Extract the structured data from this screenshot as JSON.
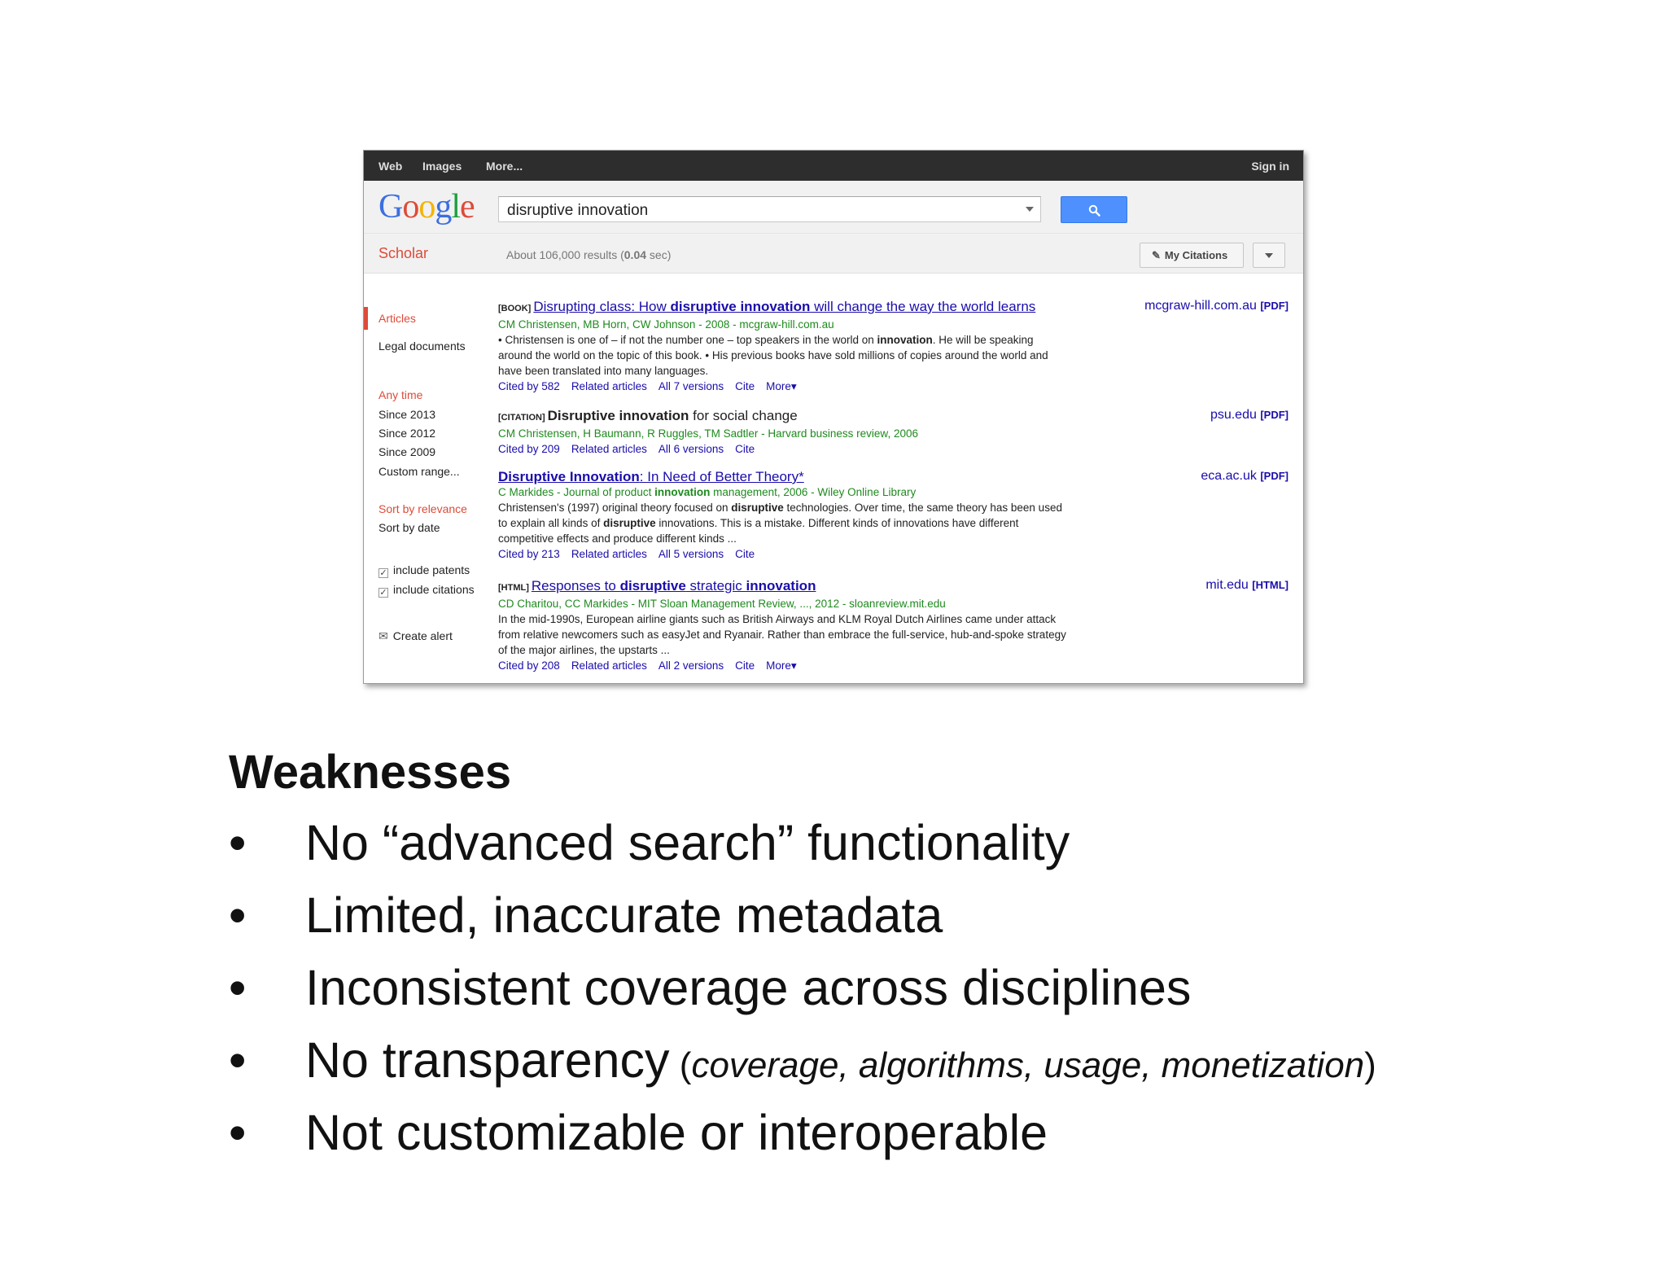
{
  "topbar": {
    "nav": [
      "Web",
      "Images",
      "More..."
    ],
    "signin": "Sign in"
  },
  "logo": {
    "letters": [
      "G",
      "o",
      "o",
      "g",
      "l",
      "e"
    ],
    "colors": [
      "#3c6fe0",
      "#dd4b39",
      "#f4b400",
      "#3c6fe0",
      "#1e9e3e",
      "#dd4b39"
    ]
  },
  "search": {
    "value": "disruptive innovation"
  },
  "subheader": {
    "scholar": "Scholar",
    "stats_prefix": "About 106,000 results (",
    "stats_time": "0.04",
    "stats_suffix": " sec)",
    "my_citations": "My Citations"
  },
  "leftcol": {
    "types": [
      "Articles",
      "Legal documents"
    ],
    "time": [
      "Any time",
      "Since 2013",
      "Since 2012",
      "Since 2009",
      "Custom range..."
    ],
    "sort": [
      "Sort by relevance",
      "Sort by date"
    ],
    "include": [
      "include patents",
      "include citations"
    ],
    "alert": "Create alert"
  },
  "results": [
    {
      "tag": "[BOOK]",
      "title_a": "Disrupting class: How ",
      "title_b": "disruptive innovation",
      "title_c": " will change the way the world learns",
      "meta": "CM Christensen, MB Horn, CW Johnson - 2008 - mcgraw-hill.com.au",
      "snippet_1": "• Christensen is one of – if not the number one – top speakers in the world on ",
      "snippet_bold": "innovation",
      "snippet_2": ". He will be speaking around the world on the topic of this book. • His previous books have sold millions of copies around the world and have been translated into many languages.",
      "links": [
        "Cited by 582",
        "Related articles",
        "All 7 versions",
        "Cite",
        "More▾"
      ],
      "side_domain": "mcgraw-hill.com.au",
      "side_fmt": "[PDF]"
    },
    {
      "tag": "[CITATION]",
      "title_a": "",
      "title_b": "Disruptive innovation",
      "title_c": " for social change",
      "meta": "CM Christensen, H Baumann, R Ruggles, TM Sadtler - Harvard business review, 2006",
      "links": [
        "Cited by 209",
        "Related articles",
        "All 6 versions",
        "Cite"
      ],
      "side_domain": "psu.edu",
      "side_fmt": "[PDF]"
    },
    {
      "title_b": "Disruptive Innovation",
      "title_c": ": In Need of Better Theory*",
      "meta_a": "C Markides - Journal of product ",
      "meta_bold": "innovation",
      "meta_b": " management, 2006 - Wiley Online Library",
      "snippet_1": "Christensen's (1997) original theory focused on ",
      "snippet_bold": "disruptive",
      "snippet_2": " technologies. Over time, the same theory has been used to explain all kinds of ",
      "snippet_bold2": "disruptive",
      "snippet_3": " innovations. This is a mistake. Different kinds of innovations have different competitive effects and produce different kinds ...",
      "links": [
        "Cited by 213",
        "Related articles",
        "All 5 versions",
        "Cite"
      ],
      "side_domain": "eca.ac.uk",
      "side_fmt": "[PDF]"
    },
    {
      "tag": "[HTML]",
      "title_a": "Responses to ",
      "title_b": "disruptive",
      "title_c": " strategic ",
      "title_d": "innovation",
      "meta": "CD Charitou, CC Markides - MIT Sloan Management Review, ..., 2012 - sloanreview.mit.edu",
      "snippet": "In the mid-1990s, European airline giants such as British Airways and KLM Royal Dutch Airlines came under attack from relative newcomers such as easyJet and Ryanair. Rather than embrace the full-service, hub-and-spoke strategy of the major airlines, the upstarts ...",
      "links": [
        "Cited by 208",
        "Related articles",
        "All 2 versions",
        "Cite",
        "More▾"
      ],
      "side_domain": "mit.edu",
      "side_fmt": "[HTML]"
    }
  ],
  "slide": {
    "heading": "Weaknesses",
    "bullet_char": "•",
    "bullets": [
      "No “advanced search” functionality",
      "Limited, inaccurate metadata",
      "Inconsistent coverage across disciplines",
      "No transparency",
      "Not customizable or interoperable"
    ],
    "bullet4_paren_open": " (",
    "bullet4_italic": "coverage, algorithms, usage, monetization",
    "bullet4_paren_close": ")"
  }
}
